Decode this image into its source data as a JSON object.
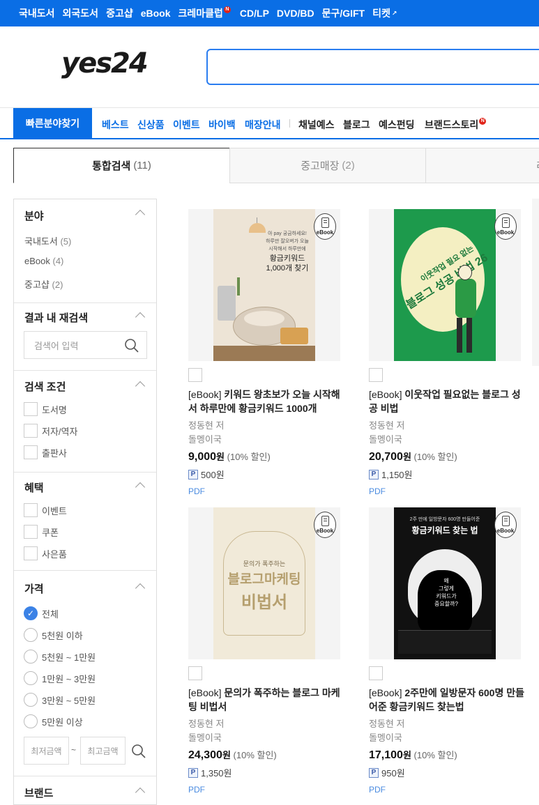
{
  "topnav": {
    "items": [
      "국내도서",
      "외국도서",
      "중고샵",
      "eBook",
      "크레마클럽",
      "CD/LP",
      "DVD/BD",
      "문구/GIFT",
      "티켓"
    ],
    "new_badge": "N",
    "ticket_ext": "↗"
  },
  "logo": "yes24",
  "search": {
    "placeholder": ""
  },
  "catnav": {
    "quick": "빠른분야찾기",
    "blue": [
      "베스트",
      "신상품",
      "이벤트",
      "바이백",
      "매장안내"
    ],
    "dark": [
      "채널예스",
      "블로그",
      "예스펀딩",
      "브랜드스토리"
    ]
  },
  "tabs": [
    {
      "label": "통합검색",
      "count": "(11)"
    },
    {
      "label": "중고매장",
      "count": "(2)"
    },
    {
      "label": "리",
      "count": ""
    }
  ],
  "filters": {
    "field": {
      "title": "분야",
      "items": [
        {
          "label": "국내도서",
          "count": "(5)"
        },
        {
          "label": "eBook",
          "count": "(4)"
        },
        {
          "label": "중고샵",
          "count": "(2)"
        }
      ]
    },
    "research": {
      "title": "결과 내 재검색",
      "placeholder": "검색어 입력"
    },
    "condition": {
      "title": "검색 조건",
      "items": [
        "도서명",
        "저자/역자",
        "출판사"
      ]
    },
    "benefit": {
      "title": "혜택",
      "items": [
        "이벤트",
        "쿠폰",
        "사은품"
      ]
    },
    "price": {
      "title": "가격",
      "items": [
        "전체",
        "5천원 이하",
        "5천원 ~ 1만원",
        "1만원 ~ 3만원",
        "3만원 ~ 5만원",
        "5만원 이상"
      ],
      "selected": 0,
      "min_placeholder": "최저금액",
      "max_placeholder": "최고금액",
      "tilde": "~"
    },
    "brand": {
      "title": "브랜드"
    }
  },
  "products": [
    {
      "prefix": "[eBook]",
      "title": "키워드 왕초보가 오늘 시작해서 하루만에 황금키워드 1000개",
      "author": "정동현 저",
      "publisher": "돌멩이국",
      "price": "9,000",
      "won": "원",
      "discount": "(10% 할인)",
      "point": "500원",
      "format": "PDF",
      "badge": "eBook",
      "cover": {
        "bg": "#ede4d6",
        "text": [
          "아 pay 궁금하세요!",
          "하루만 잘오버가 오늘",
          "시작해서 하루만에",
          "황금키워드",
          "1,000개 찾기"
        ]
      }
    },
    {
      "prefix": "[eBook]",
      "title": "이웃작업 필요없는 블로그 성공 비법",
      "author": "정동현 저",
      "publisher": "돌멩이국",
      "price": "20,700",
      "won": "원",
      "discount": "(10% 할인)",
      "point": "1,150원",
      "format": "PDF",
      "badge": "eBook",
      "cover": {
        "bg": "#1d9a4c",
        "text": [
          "이웃작업 필요 없는",
          "블로그 성공 비법 26"
        ]
      }
    },
    {
      "prefix": "[eBook]",
      "title": "문의가 폭주하는 블로그 마케팅 비법서",
      "author": "정동현 저",
      "publisher": "돌멩이국",
      "price": "24,300",
      "won": "원",
      "discount": "(10% 할인)",
      "point": "1,350원",
      "format": "PDF",
      "badge": "eBook",
      "cover": {
        "bg": "#f1ead9",
        "text": [
          "문의가 폭주하는",
          "블로그마케팅",
          "비법서"
        ]
      }
    },
    {
      "prefix": "[eBook]",
      "title": "2주만에 일방문자 600명 만들어준 황금키워드 찾는법",
      "author": "정동현 저",
      "publisher": "돌멩이국",
      "price": "17,100",
      "won": "원",
      "discount": "(10% 할인)",
      "point": "950원",
      "format": "PDF",
      "badge": "eBook",
      "cover": {
        "bg": "#111111",
        "text": [
          "2주 만에 일방문자 600명 만들어준",
          "황금키워드 찾는 법",
          "왜",
          "그렇게",
          "키워드가",
          "중요할까?"
        ]
      }
    }
  ],
  "colors": {
    "brand_blue": "#0a6ee5",
    "new_red": "#e0241a",
    "format_blue": "#4a8be0"
  }
}
